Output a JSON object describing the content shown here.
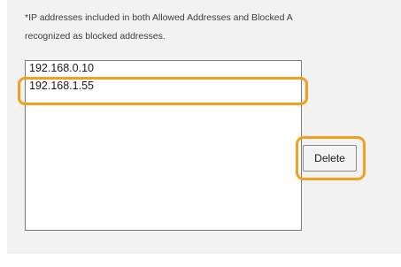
{
  "note": {
    "line1": "*IP addresses included in both Allowed Addresses and Blocked A",
    "line2": "recognized as blocked addresses."
  },
  "address_list": {
    "items": [
      {
        "label": "192.168.0.10",
        "selected": false
      },
      {
        "label": "192.168.1.55",
        "selected": true
      }
    ]
  },
  "actions": {
    "delete_label": "Delete"
  },
  "colors": {
    "highlight": "#f2a01e",
    "panel_background": "#f2f2f2"
  }
}
